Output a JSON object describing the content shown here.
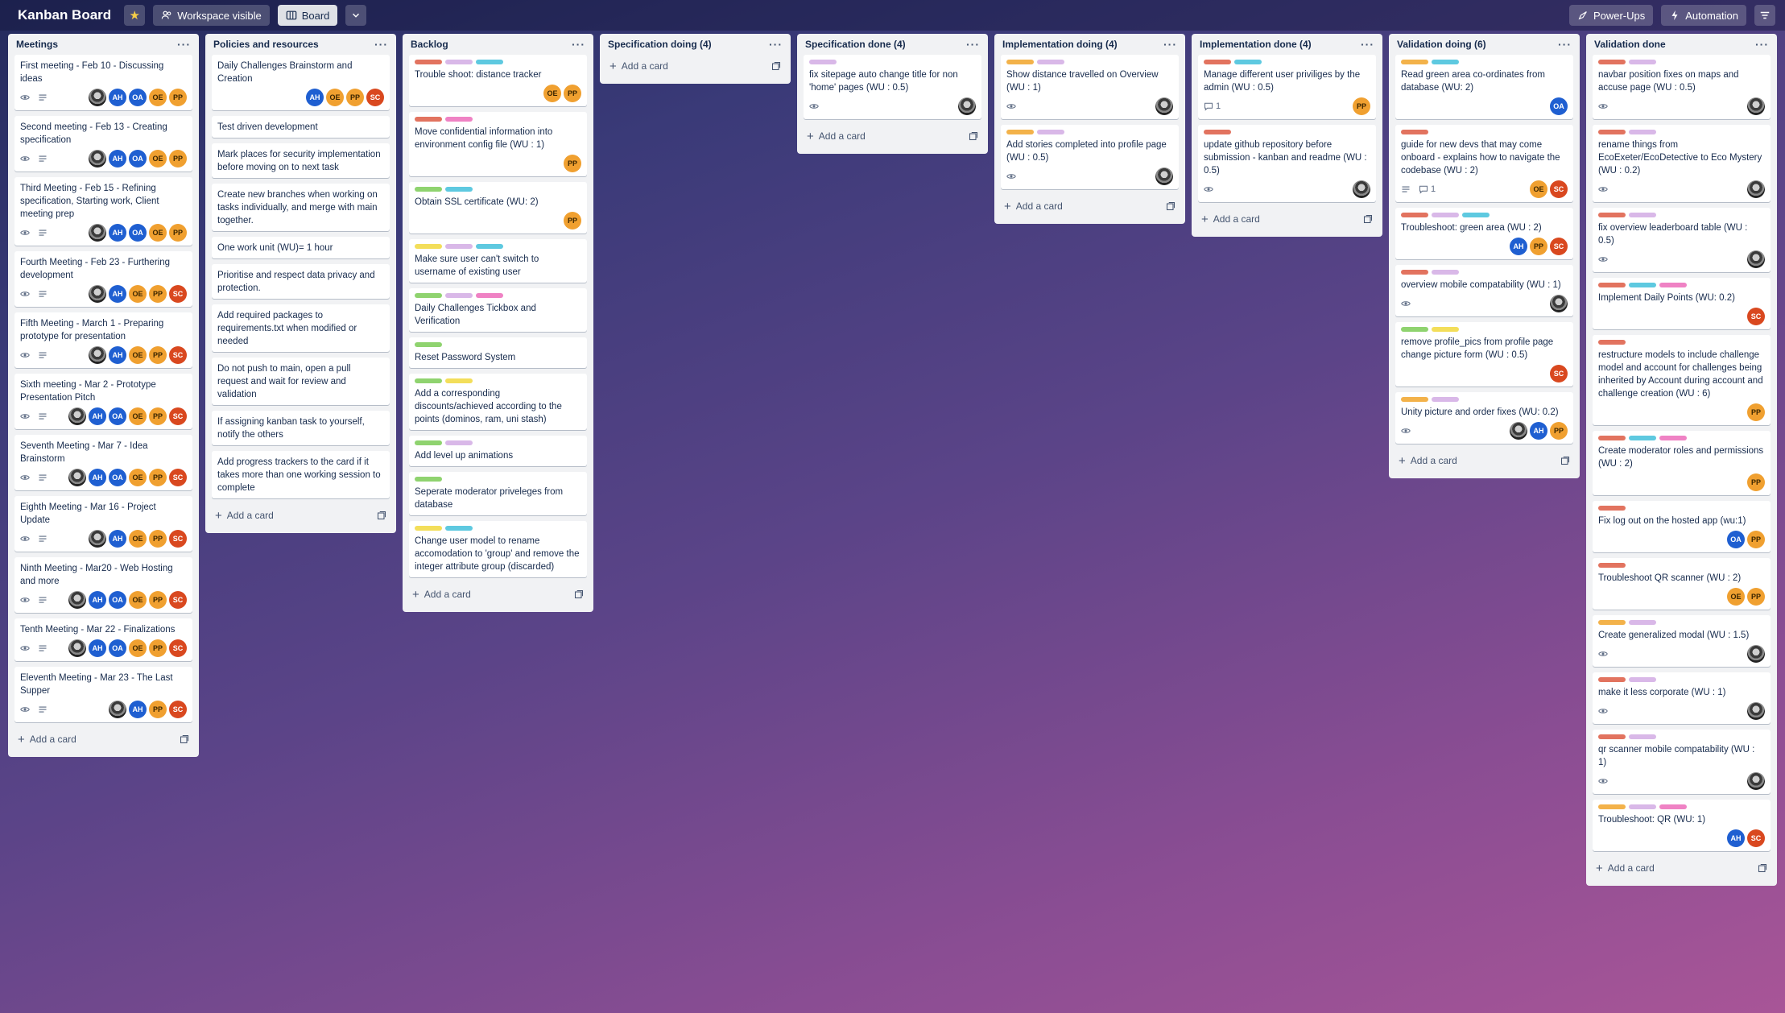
{
  "header": {
    "title": "Kanban Board",
    "visibility_label": "Workspace visible",
    "view_label": "Board",
    "powerups_label": "Power-Ups",
    "automation_label": "Automation"
  },
  "colors": {
    "red": "#e2735f",
    "purple": "#d9b8e8",
    "teal": "#5ec9e0",
    "green": "#8fd36f",
    "yellow": "#f3de5a",
    "orange": "#f3b24a",
    "pink": "#ef82c4"
  },
  "common": {
    "add_card": "Add a card"
  },
  "lists": [
    {
      "title": "Meetings",
      "cards": [
        {
          "title": "First meeting - Feb 10 - Discussing ideas",
          "watch": true,
          "desc": true,
          "members": [
            "photo",
            "AH",
            "OA",
            "OE",
            "PP"
          ]
        },
        {
          "title": "Second meeting - Feb 13 - Creating specification",
          "watch": true,
          "desc": true,
          "members": [
            "photo",
            "AH",
            "OA",
            "OE",
            "PP"
          ]
        },
        {
          "title": "Third Meeting - Feb 15 - Refining specification, Starting work, Client meeting prep",
          "watch": true,
          "desc": true,
          "members": [
            "photo",
            "AH",
            "OA",
            "OE",
            "PP"
          ]
        },
        {
          "title": "Fourth Meeting - Feb 23 - Furthering development",
          "watch": true,
          "desc": true,
          "members": [
            "photo",
            "AH",
            "OE",
            "PP",
            "SC"
          ]
        },
        {
          "title": "Fifth Meeting - March 1 - Preparing prototype for presentation",
          "watch": true,
          "desc": true,
          "members": [
            "photo",
            "AH",
            "OE",
            "PP",
            "SC"
          ]
        },
        {
          "title": "Sixth meeting - Mar 2 - Prototype Presentation Pitch",
          "watch": true,
          "desc": true,
          "members": [
            "photo",
            "AH",
            "OA",
            "OE",
            "PP",
            "SC"
          ]
        },
        {
          "title": "Seventh Meeting - Mar 7 - Idea Brainstorm",
          "watch": true,
          "desc": true,
          "members": [
            "photo",
            "AH",
            "OA",
            "OE",
            "PP",
            "SC"
          ]
        },
        {
          "title": "Eighth Meeting - Mar 16 - Project Update",
          "watch": true,
          "desc": true,
          "members": [
            "photo",
            "AH",
            "OE",
            "PP",
            "SC"
          ]
        },
        {
          "title": "Ninth Meeting - Mar20 - Web Hosting and more",
          "watch": true,
          "desc": true,
          "members": [
            "photo",
            "AH",
            "OA",
            "OE",
            "PP",
            "SC"
          ]
        },
        {
          "title": "Tenth Meeting - Mar 22 - Finalizations",
          "watch": true,
          "desc": true,
          "members": [
            "photo",
            "AH",
            "OA",
            "OE",
            "PP",
            "SC"
          ]
        },
        {
          "title": "Eleventh Meeting - Mar 23 - The Last Supper",
          "watch": true,
          "desc": true,
          "members": [
            "photo",
            "AH",
            "PP",
            "SC"
          ]
        }
      ]
    },
    {
      "title": "Policies and resources",
      "cards": [
        {
          "title": "Daily Challenges Brainstorm and Creation",
          "members": [
            "AH",
            "OE",
            "PP",
            "SC"
          ]
        },
        {
          "title": "Test driven development"
        },
        {
          "title": "Mark places for security implementation before moving on to next task"
        },
        {
          "title": "Create new branches when working on tasks individually, and merge with main together."
        },
        {
          "title": "One work unit (WU)= 1 hour"
        },
        {
          "title": "Prioritise and respect data privacy and protection."
        },
        {
          "title": "Add required packages to requirements.txt when modified or needed"
        },
        {
          "title": "Do not push to main, open a pull request and wait for review and validation"
        },
        {
          "title": "If assigning kanban task to yourself, notify the others"
        },
        {
          "title": "Add progress trackers to the card if it takes more than one working session to complete"
        }
      ]
    },
    {
      "title": "Backlog",
      "cards": [
        {
          "labels": [
            "red",
            "purple",
            "teal"
          ],
          "title": "Trouble shoot: distance tracker",
          "members": [
            "OE",
            "PP"
          ]
        },
        {
          "labels": [
            "red",
            "pink"
          ],
          "title": "Move confidential information into environment config file (WU : 1)",
          "members": [
            "PP"
          ]
        },
        {
          "labels": [
            "green",
            "teal"
          ],
          "title": "Obtain SSL certificate (WU: 2)",
          "members": [
            "PP"
          ]
        },
        {
          "labels": [
            "yellow",
            "purple",
            "teal"
          ],
          "title": "Make sure user can't switch to username of existing user"
        },
        {
          "labels": [
            "green",
            "purple",
            "pink"
          ],
          "title": "Daily Challenges Tickbox and Verification"
        },
        {
          "labels": [
            "green"
          ],
          "title": "Reset Password System"
        },
        {
          "labels": [
            "green",
            "yellow"
          ],
          "title": "Add a corresponding discounts/achieved according to the points (dominos, ram, uni stash)"
        },
        {
          "labels": [
            "green",
            "purple"
          ],
          "title": "Add level up animations"
        },
        {
          "labels": [
            "green"
          ],
          "title": "Seperate moderator priveleges from database"
        },
        {
          "labels": [
            "yellow",
            "teal"
          ],
          "title": "Change user model to rename accomodation to 'group' and remove the integer attribute group (discarded)"
        }
      ]
    },
    {
      "title": "Specification doing (4)",
      "cards": []
    },
    {
      "title": "Specification done (4)",
      "cards": [
        {
          "labels": [
            "purple"
          ],
          "title": "fix sitepage auto change title for non 'home' pages (WU : 0.5)",
          "watch": true,
          "members": [
            "photo"
          ]
        }
      ]
    },
    {
      "title": "Implementation doing (4)",
      "cards": [
        {
          "labels": [
            "orange",
            "purple"
          ],
          "title": "Show distance travelled on Overview (WU : 1)",
          "watch": true,
          "members": [
            "photo"
          ]
        },
        {
          "labels": [
            "orange",
            "purple"
          ],
          "title": "Add stories completed into profile page (WU : 0.5)",
          "watch": true,
          "members": [
            "photo"
          ]
        }
      ]
    },
    {
      "title": "Implementation done (4)",
      "cards": [
        {
          "labels": [
            "red",
            "teal"
          ],
          "title": "Manage different user priviliges by the admin (WU : 0.5)",
          "comments": "1",
          "members": [
            "PP"
          ]
        },
        {
          "labels": [
            "red"
          ],
          "title": "update github repository before submission - kanban and readme (WU : 0.5)",
          "watch": true,
          "members": [
            "photo"
          ]
        }
      ]
    },
    {
      "title": "Validation doing (6)",
      "cards": [
        {
          "labels": [
            "orange",
            "teal"
          ],
          "title": "Read green area co-ordinates from database (WU: 2)",
          "members": [
            "OA"
          ]
        },
        {
          "labels": [
            "red"
          ],
          "title": "guide for new devs that may come onboard - explains how to navigate the codebase (WU : 2)",
          "desc": true,
          "comments": "1",
          "members": [
            "OE",
            "SC"
          ]
        },
        {
          "labels": [
            "red",
            "purple",
            "teal"
          ],
          "title": "Troubleshoot: green area (WU : 2)",
          "members": [
            "AH",
            "PP",
            "SC"
          ]
        },
        {
          "labels": [
            "red",
            "purple"
          ],
          "title": "overview mobile compatability (WU : 1)",
          "watch": true,
          "members": [
            "photo"
          ]
        },
        {
          "labels": [
            "green",
            "yellow"
          ],
          "title": "remove profile_pics from profile page change picture form (WU : 0.5)",
          "members": [
            "SC"
          ]
        },
        {
          "labels": [
            "orange",
            "purple"
          ],
          "title": "Unity picture and order fixes (WU: 0.2)",
          "watch": true,
          "members": [
            "photo",
            "AH",
            "PP"
          ]
        }
      ]
    },
    {
      "title": "Validation done",
      "cards": [
        {
          "labels": [
            "red",
            "purple"
          ],
          "title": "navbar position fixes on maps and accuse page (WU : 0.5)",
          "watch": true,
          "members": [
            "photo"
          ]
        },
        {
          "labels": [
            "red",
            "purple"
          ],
          "title": "rename things from EcoExeter/EcoDetective to Eco Mystery (WU : 0.2)",
          "watch": true,
          "members": [
            "photo"
          ]
        },
        {
          "labels": [
            "red",
            "purple"
          ],
          "title": "fix overview leaderboard table (WU : 0.5)",
          "watch": true,
          "members": [
            "photo"
          ]
        },
        {
          "labels": [
            "red",
            "teal",
            "pink"
          ],
          "title": "Implement Daily Points (WU: 0.2)",
          "members": [
            "SC"
          ]
        },
        {
          "labels": [
            "red"
          ],
          "title": "restructure models to include challenge model and account for challenges being inherited by Account during account and challenge creation (WU : 6)",
          "members": [
            "PP"
          ]
        },
        {
          "labels": [
            "red",
            "teal",
            "pink"
          ],
          "title": "Create moderator roles and permissions (WU : 2)",
          "members": [
            "PP"
          ]
        },
        {
          "labels": [
            "red"
          ],
          "title": "Fix log out on the hosted app (wu:1)",
          "members": [
            "OA",
            "PP"
          ]
        },
        {
          "labels": [
            "red"
          ],
          "title": "Troubleshoot QR scanner (WU : 2)",
          "members": [
            "OE",
            "PP"
          ]
        },
        {
          "labels": [
            "orange",
            "purple"
          ],
          "title": "Create generalized modal (WU : 1.5)",
          "watch": true,
          "members": [
            "photo"
          ]
        },
        {
          "labels": [
            "red",
            "purple"
          ],
          "title": "make it less corporate (WU : 1)",
          "watch": true,
          "members": [
            "photo"
          ]
        },
        {
          "labels": [
            "red",
            "purple"
          ],
          "title": "qr scanner mobile compatability (WU : 1)",
          "watch": true,
          "members": [
            "photo"
          ]
        },
        {
          "labels": [
            "orange",
            "purple",
            "pink"
          ],
          "title": "Troubleshoot: QR (WU: 1)",
          "members": [
            "AH",
            "SC"
          ]
        }
      ]
    }
  ]
}
